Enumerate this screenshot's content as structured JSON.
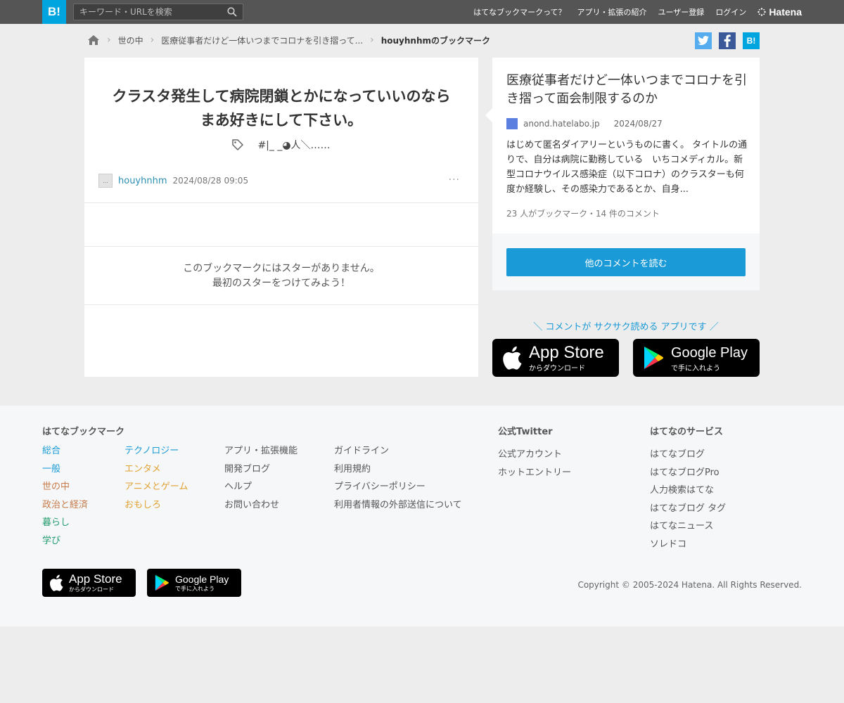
{
  "header": {
    "logo": "B!",
    "search_placeholder": "キーワード・URLを検索",
    "nav": [
      "はてなブックマークって？",
      "アプリ・拡張の紹介",
      "ユーザー登録",
      "ログイン"
    ],
    "brand": "Hatena"
  },
  "breadcrumb": {
    "items": [
      "世の中",
      "医療従事者だけど一体いつまでコロナを引き摺って..."
    ],
    "current": "houyhnhmのブックマーク"
  },
  "share": {
    "twitter": "t",
    "facebook": "f",
    "hatena": "B!"
  },
  "bookmark": {
    "comment": "クラスタ発生して病院閉鎖とかになっていいのならまあ好きにして下さい。",
    "tag": "#|_ _◕人＼……",
    "user": "houyhnhm",
    "avatar_text": "...",
    "date": "2024/08/28 09:05",
    "more": "···",
    "no_stars_line1": "このブックマークにはスターがありません。",
    "no_stars_line2": "最初のスターをつけてみよう！"
  },
  "entry": {
    "title": "医療従事者だけど一体いつまでコロナを引き摺って面会制限するのか",
    "domain": "anond.hatelabo.jp",
    "date": "2024/08/27",
    "description": "はじめて匿名ダイアリーというものに書く。 タイトルの通りで、自分は病院に勤務している　いちコメディカル。新型コロナウイルス感染症（以下コロナ）のクラスターも何度か経験し、その感染力であるとか、自身...",
    "counts": "23 人がブックマーク・14 件のコメント",
    "read_button": "他のコメントを読む"
  },
  "promo": {
    "text": "＼ コメントが サクサク読める アプリです ／",
    "appstore_big": "App Store",
    "appstore_small": "からダウンロード",
    "googleplay_big": "Google Play",
    "googleplay_small": "で手に入れよう"
  },
  "footer": {
    "col1_title": "はてなブックマーク",
    "categories_a": [
      {
        "label": "総合",
        "color": "#1a9ad6"
      },
      {
        "label": "一般",
        "color": "#1a9ad6"
      },
      {
        "label": "世の中",
        "color": "#c67b4a"
      },
      {
        "label": "政治と経済",
        "color": "#c67b4a"
      },
      {
        "label": "暮らし",
        "color": "#239b6e"
      },
      {
        "label": "学び",
        "color": "#239b6e"
      }
    ],
    "categories_b": [
      {
        "label": "テクノロジー",
        "color": "#1a9ad6"
      },
      {
        "label": "エンタメ",
        "color": "#e2a233"
      },
      {
        "label": "アニメとゲーム",
        "color": "#e2a233"
      },
      {
        "label": "おもしろ",
        "color": "#e2a233"
      }
    ],
    "links_c": [
      "アプリ・拡張機能",
      "開発ブログ",
      "ヘルプ",
      "お問い合わせ"
    ],
    "links_d": [
      "ガイドライン",
      "利用規約",
      "プライバシーポリシー",
      "利用者情報の外部送信について"
    ],
    "twitter_title": "公式Twitter",
    "twitter_links": [
      "公式アカウント",
      "ホットエントリー"
    ],
    "services_title": "はてなのサービス",
    "services": [
      "はてなブログ",
      "はてなブログPro",
      "人力検索はてな",
      "はてなブログ タグ",
      "はてなニュース",
      "ソレドコ"
    ],
    "copyright": "Copyright © 2005-2024 Hatena. All Rights Reserved."
  }
}
